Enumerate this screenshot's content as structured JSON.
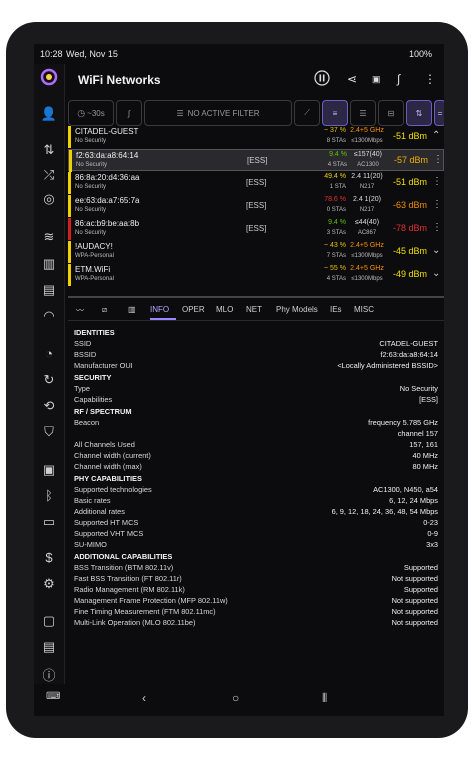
{
  "status": {
    "time": "10:28",
    "date": "Wed, Nov 15",
    "battery": "100%"
  },
  "app": {
    "title": "WiFi Networks"
  },
  "appbar_icons": [
    "pause-icon",
    "share-icon",
    "export-icon",
    "chart-icon",
    "more-icon"
  ],
  "toolbar": {
    "timer_label": "~30s",
    "filter_label": "NO ACTIVE FILTER"
  },
  "networks": [
    {
      "ssid": "CITADEL-GUEST",
      "security": "No Security",
      "tag": "",
      "pct": "~ 37 %",
      "stas": "8 STAs",
      "band": "2.4+5 GHz",
      "rate": "≤1300Mbps",
      "dbm": "-51 dBm",
      "bar": "#f0d000",
      "pct_color": "#e0c000",
      "dbm_color": "#f0e000",
      "band_color": "#ff9000",
      "group": true
    },
    {
      "ssid": "f2:63:da:a8:64:14",
      "security": "No Security",
      "tag": "[ESS]",
      "pct": "9.4 %",
      "stas": "4 STAs",
      "band": "≤157(40)",
      "rate": "AC1300",
      "dbm": "-57 dBm",
      "bar": "#f0d000",
      "pct_color": "#60c000",
      "dbm_color": "#f0b000",
      "band_color": "#ddd",
      "selected": true
    },
    {
      "ssid": "86:8a:20:d4:36:aa",
      "security": "No Security",
      "tag": "[ESS]",
      "pct": "49.4 %",
      "stas": "1 STA",
      "band": "2.4 11(20)",
      "rate": "N217",
      "dbm": "-51 dBm",
      "bar": "#f0d000",
      "pct_color": "#f0d000",
      "dbm_color": "#f0e000",
      "band_color": "#ddd"
    },
    {
      "ssid": "ee:63:da:a7:65:7a",
      "security": "No Security",
      "tag": "[ESS]",
      "pct": "78.6 %",
      "stas": "0 STAs",
      "band": "2.4 1(20)",
      "rate": "N217",
      "dbm": "-63 dBm",
      "bar": "#f0d000",
      "pct_color": "#e03030",
      "dbm_color": "#f09000",
      "band_color": "#ddd"
    },
    {
      "ssid": "86:ac:b9:be:aa:8b",
      "security": "No Security",
      "tag": "[ESS]",
      "pct": "9.4 %",
      "stas": "3 STAs",
      "band": "≤44(40)",
      "rate": "AC867",
      "dbm": "-78 dBm",
      "bar": "#d02020",
      "pct_color": "#60c000",
      "dbm_color": "#e03030",
      "band_color": "#ddd"
    },
    {
      "ssid": "!AUDACY!",
      "security": "WPA-Personal",
      "tag": "",
      "pct": "~ 43 %",
      "stas": "7 STAs",
      "band": "2.4+5 GHz",
      "rate": "≤1300Mbps",
      "dbm": "-45 dBm",
      "bar": "#f0d000",
      "pct_color": "#e0c000",
      "dbm_color": "#f0e000",
      "band_color": "#ff9000",
      "group": true
    },
    {
      "ssid": "ETM.WiFi",
      "security": "WPA-Personal",
      "tag": "",
      "pct": "~ 55 %",
      "stas": "4 STAs",
      "band": "2.4+5 GHz",
      "rate": "≤1300Mbps",
      "dbm": "-49 dBm",
      "bar": "#f0d000",
      "pct_color": "#e0c000",
      "dbm_color": "#f0e000",
      "band_color": "#ff9000",
      "group": true
    }
  ],
  "tabs": [
    "INFO",
    "OPER",
    "MLO",
    "NET",
    "Phy Models",
    "IEs",
    "MISC"
  ],
  "details": {
    "identities": "IDENTITIES",
    "ssid_k": "SSID",
    "ssid_v": "CITADEL-GUEST",
    "bssid_k": "BSSID",
    "bssid_v": "f2:63:da:a8:64:14",
    "oui_k": "Manufacturer OUI",
    "oui_v": "<Locally Administered BSSID>",
    "security": "SECURITY",
    "type_k": "Type",
    "type_v": "No Security",
    "cap_k": "Capabilities",
    "cap_v": "[ESS]",
    "rf": "RF / SPECTRUM",
    "beacon_k": "Beacon",
    "beacon_v1": "frequency 5.785 GHz",
    "beacon_v2": "channel 157",
    "allch_k": "All Channels Used",
    "allch_v": "157, 161",
    "cw_k": "Channel width (current)",
    "cw_v": "40 MHz",
    "cwm_k": "Channel width (max)",
    "cwm_v": "80 MHz",
    "phy": "PHY CAPABILITIES",
    "tech_k": "Supported technologies",
    "tech_v": "AC1300, N450, a54",
    "basic_k": "Basic rates",
    "basic_v": "6, 12, 24 Mbps",
    "add_k": "Additional rates",
    "add_v": "6, 9, 12, 18, 24, 36, 48, 54 Mbps",
    "ht_k": "Supported HT MCS",
    "ht_v": "0-23",
    "vht_k": "Supported VHT MCS",
    "vht_v": "0-9",
    "mimo_k": "SU-MIMO",
    "mimo_v": "3x3",
    "addcap": "ADDITIONAL CAPABILITIES",
    "btm_k": "BSS Transition (BTM 802.11v)",
    "btm_v": "Supported",
    "ft_k": "Fast BSS Transition (FT 802.11r)",
    "ft_v": "Not supported",
    "rm_k": "Radio Management (RM 802.11k)",
    "rm_v": "Supported",
    "mfp_k": "Management Frame Protection (MFP 802.11w)",
    "mfp_v": "Not supported",
    "ftm_k": "Fine Timing Measurement (FTM 802.11mc)",
    "ftm_v": "Not supported",
    "mlo_k": "Multi-Link Operation (MLO 802.11be)",
    "mlo_v": "Not supported"
  }
}
